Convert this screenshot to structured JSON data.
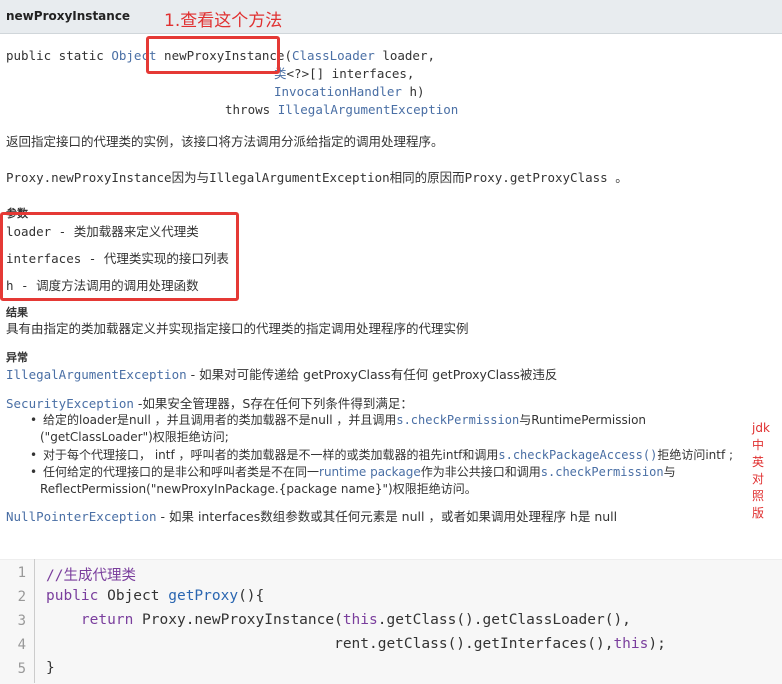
{
  "header": {
    "title": "newProxyInstance",
    "annotation": "1.查看这个方法"
  },
  "signature": {
    "line1_prefix": "public static ",
    "line1_type": "Object",
    "method": "newProxyInstance",
    "line1_paren": "(",
    "line1_param_type": "ClassLoader",
    "line1_param": " loader,",
    "line2_type": "类",
    "line2_param": "<?>[] interfaces,",
    "line3_type": "InvocationHandler",
    "line3_param": " h)",
    "line4_throws": "throws ",
    "line4_exception": "IllegalArgumentException"
  },
  "description": {
    "summary": "返回指定接口的代理类的实例，该接口将方法调用分派给指定的调用处理程序。",
    "detail": "Proxy.newProxyInstance因为与IllegalArgumentException相同的原因而Proxy.getProxyClass 。"
  },
  "params": {
    "label": "参数",
    "items": [
      "loader - 类加载器来定义代理类",
      "interfaces - 代理类实现的接口列表",
      "h - 调度方法调用的调用处理函数"
    ]
  },
  "result": {
    "label": "结果",
    "text": "具有由指定的类加载器定义并实现指定接口的代理类的指定调用处理程序的代理实例"
  },
  "exceptions": {
    "label": "异常",
    "illegal_name": "IllegalArgumentException",
    "illegal_text": " - 如果对可能传递给 getProxyClass有任何 getProxyClass被违反",
    "security_name": "SecurityException",
    "security_text": " -如果安全管理器，S存在任何下列条件得到满足：",
    "bullet1a_pre": "给定的loader是null ，并且调用者的类加载器不是null ，并且调用",
    "bullet1a_link": "s.checkPermission",
    "bullet1a_post": "与RuntimePermission",
    "bullet1b": "(\"getClassLoader\")权限拒绝访问;",
    "bullet2_pre": "对于每个代理接口， intf ，呼叫者的类加载器是不一样的或类加载器的祖先intf和调用",
    "bullet2_link": "s.checkPackageAccess()",
    "bullet2_post": "拒绝访问intf ;",
    "bullet3a_pre": "任何给定的代理接口的是非公和呼叫者类是不在同一",
    "bullet3a_link1": "runtime package",
    "bullet3a_mid": "作为非公共接口和调用",
    "bullet3a_link2": "s.checkPermission",
    "bullet3a_post": "与",
    "bullet3b": "ReflectPermission(\"newProxyInPackage.{package name}\")权限拒绝访问。",
    "null_name": "NullPointerException",
    "null_text": " - 如果 interfaces数组参数或其任何元素是 null ，或者如果调用处理程序 h是 null"
  },
  "side_note": "jdk\n中\n英\n对\n照\n版",
  "code": {
    "line_numbers": [
      "1",
      "2",
      "3",
      "4",
      "5"
    ],
    "l1_comment": "//生成代理类",
    "l2_kw1": "public",
    "l2_type": " Object ",
    "l2_fn": "getProxy",
    "l2_rest": "(){",
    "l3_indent": "    ",
    "l3_kw": "return",
    "l3_a": " Proxy.newProxyInstance(",
    "l3_this": "this",
    "l3_b": ".getClass().getClassLoader(),",
    "l4_indent": "                                 ",
    "l4_a": "rent.getClass().getInterfaces(),",
    "l4_this": "this",
    "l4_b": ");",
    "l5": "}"
  }
}
